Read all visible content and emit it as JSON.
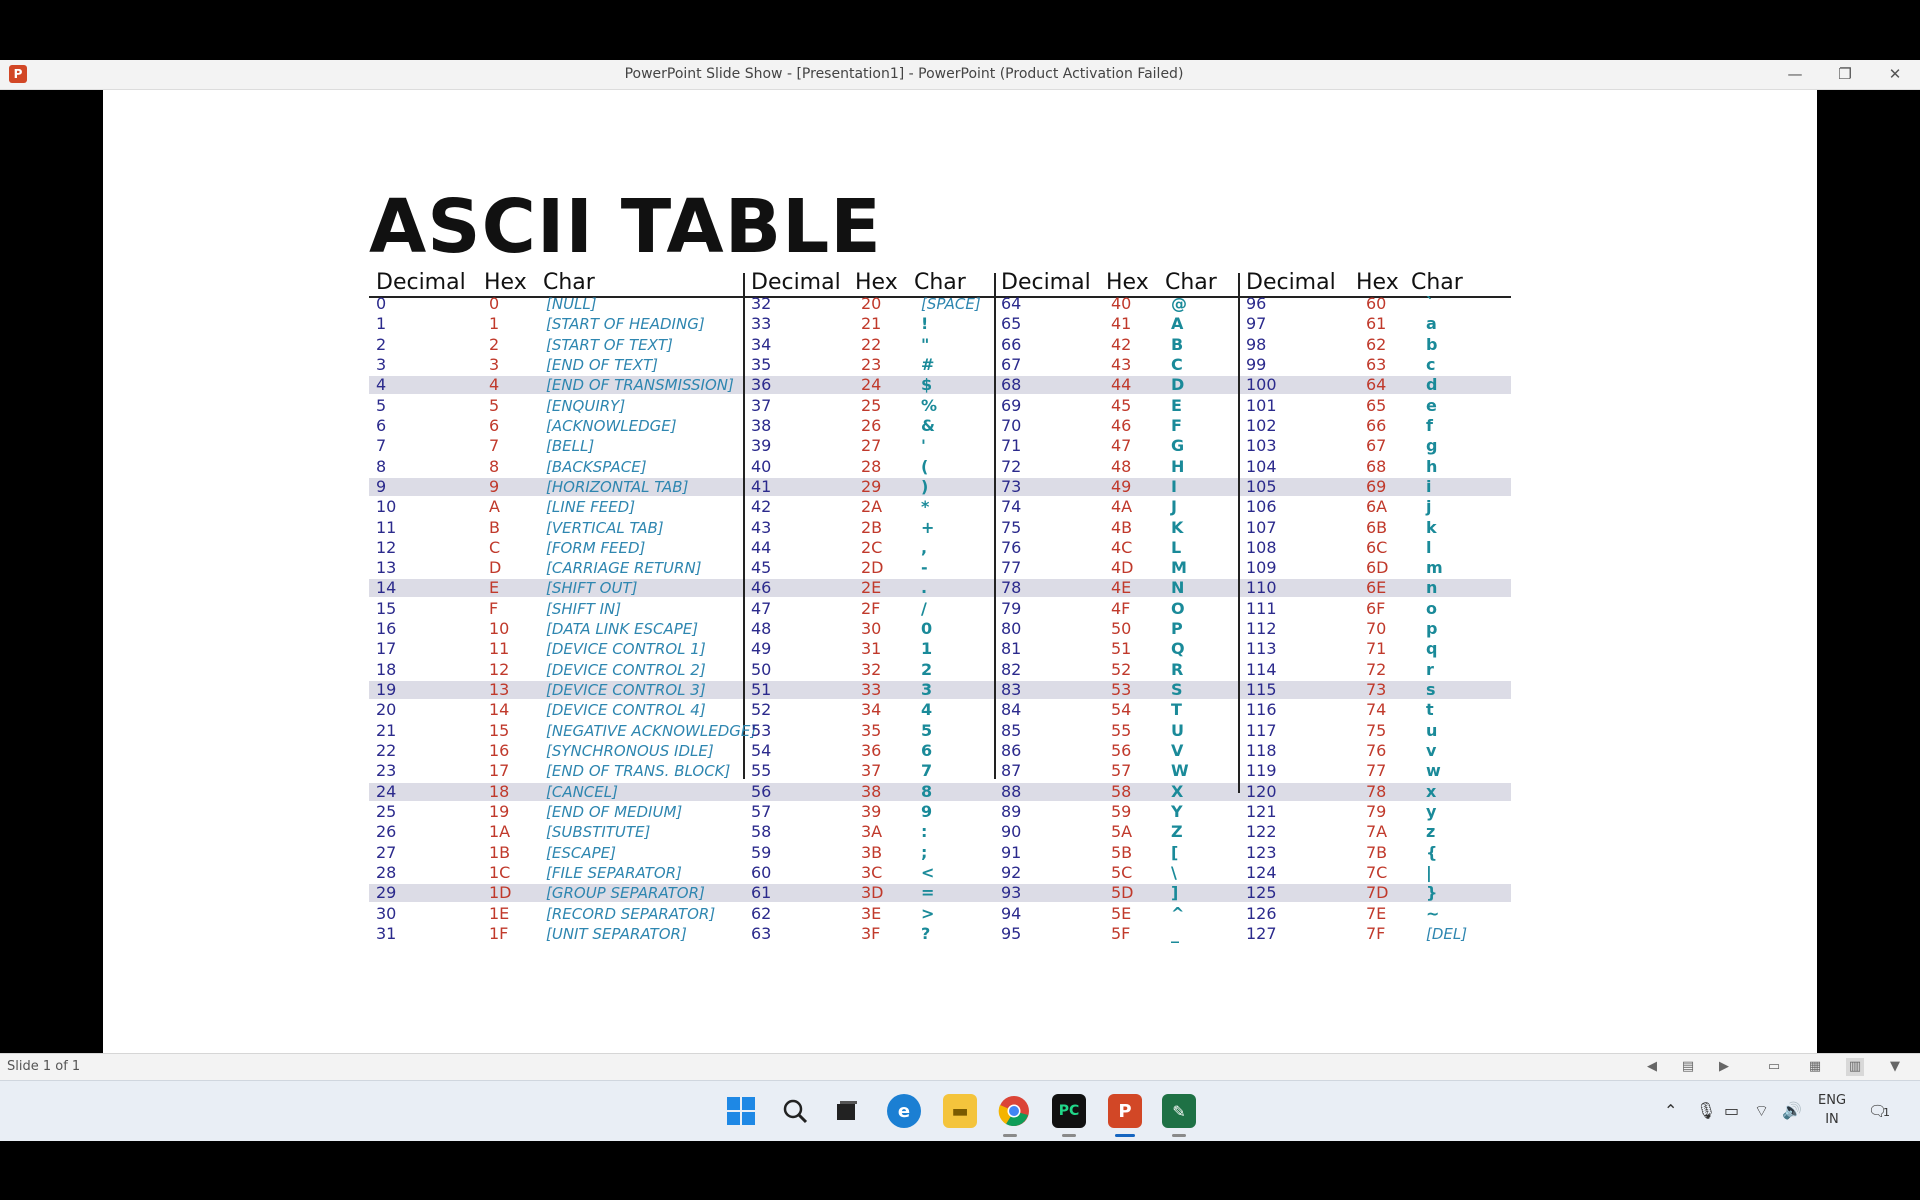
{
  "window": {
    "title": "PowerPoint Slide Show - [Presentation1] - PowerPoint (Product Activation Failed)",
    "app_icon": "P",
    "minimize": "—",
    "restore": "❐",
    "close": "✕"
  },
  "slide": {
    "title": "ASCII TABLE",
    "headers": {
      "decimal": "Decimal",
      "hex": "Hex",
      "char": "Char"
    },
    "groups": [
      {
        "rows": [
          [
            "0",
            "0",
            "[NULL]"
          ],
          [
            "1",
            "1",
            "[START OF HEADING]"
          ],
          [
            "2",
            "2",
            "[START OF TEXT]"
          ],
          [
            "3",
            "3",
            "[END OF TEXT]"
          ],
          [
            "4",
            "4",
            "[END OF TRANSMISSION]"
          ],
          [
            "5",
            "5",
            "[ENQUIRY]"
          ],
          [
            "6",
            "6",
            "[ACKNOWLEDGE]"
          ],
          [
            "7",
            "7",
            "[BELL]"
          ],
          [
            "8",
            "8",
            "[BACKSPACE]"
          ],
          [
            "9",
            "9",
            "[HORIZONTAL TAB]"
          ],
          [
            "10",
            "A",
            "[LINE FEED]"
          ],
          [
            "11",
            "B",
            "[VERTICAL TAB]"
          ],
          [
            "12",
            "C",
            "[FORM FEED]"
          ],
          [
            "13",
            "D",
            "[CARRIAGE RETURN]"
          ],
          [
            "14",
            "E",
            "[SHIFT OUT]"
          ],
          [
            "15",
            "F",
            "[SHIFT IN]"
          ],
          [
            "16",
            "10",
            "[DATA LINK ESCAPE]"
          ],
          [
            "17",
            "11",
            "[DEVICE CONTROL 1]"
          ],
          [
            "18",
            "12",
            "[DEVICE CONTROL 2]"
          ],
          [
            "19",
            "13",
            "[DEVICE CONTROL 3]"
          ],
          [
            "20",
            "14",
            "[DEVICE CONTROL 4]"
          ],
          [
            "21",
            "15",
            "[NEGATIVE ACKNOWLEDGE]"
          ],
          [
            "22",
            "16",
            "[SYNCHRONOUS IDLE]"
          ],
          [
            "23",
            "17",
            "[END OF TRANS. BLOCK]"
          ],
          [
            "24",
            "18",
            "[CANCEL]"
          ],
          [
            "25",
            "19",
            "[END OF MEDIUM]"
          ],
          [
            "26",
            "1A",
            "[SUBSTITUTE]"
          ],
          [
            "27",
            "1B",
            "[ESCAPE]"
          ],
          [
            "28",
            "1C",
            "[FILE SEPARATOR]"
          ],
          [
            "29",
            "1D",
            "[GROUP SEPARATOR]"
          ],
          [
            "30",
            "1E",
            "[RECORD SEPARATOR]"
          ],
          [
            "31",
            "1F",
            "[UNIT SEPARATOR]"
          ]
        ]
      },
      {
        "rows": [
          [
            "32",
            "20",
            "[SPACE]"
          ],
          [
            "33",
            "21",
            "!"
          ],
          [
            "34",
            "22",
            "\""
          ],
          [
            "35",
            "23",
            "#"
          ],
          [
            "36",
            "24",
            "$"
          ],
          [
            "37",
            "25",
            "%"
          ],
          [
            "38",
            "26",
            "&"
          ],
          [
            "39",
            "27",
            "'"
          ],
          [
            "40",
            "28",
            "("
          ],
          [
            "41",
            "29",
            ")"
          ],
          [
            "42",
            "2A",
            "*"
          ],
          [
            "43",
            "2B",
            "+"
          ],
          [
            "44",
            "2C",
            ","
          ],
          [
            "45",
            "2D",
            "-"
          ],
          [
            "46",
            "2E",
            "."
          ],
          [
            "47",
            "2F",
            "/"
          ],
          [
            "48",
            "30",
            "0"
          ],
          [
            "49",
            "31",
            "1"
          ],
          [
            "50",
            "32",
            "2"
          ],
          [
            "51",
            "33",
            "3"
          ],
          [
            "52",
            "34",
            "4"
          ],
          [
            "53",
            "35",
            "5"
          ],
          [
            "54",
            "36",
            "6"
          ],
          [
            "55",
            "37",
            "7"
          ],
          [
            "56",
            "38",
            "8"
          ],
          [
            "57",
            "39",
            "9"
          ],
          [
            "58",
            "3A",
            ":"
          ],
          [
            "59",
            "3B",
            ";"
          ],
          [
            "60",
            "3C",
            "<"
          ],
          [
            "61",
            "3D",
            "="
          ],
          [
            "62",
            "3E",
            ">"
          ],
          [
            "63",
            "3F",
            "?"
          ]
        ]
      },
      {
        "rows": [
          [
            "64",
            "40",
            "@"
          ],
          [
            "65",
            "41",
            "A"
          ],
          [
            "66",
            "42",
            "B"
          ],
          [
            "67",
            "43",
            "C"
          ],
          [
            "68",
            "44",
            "D"
          ],
          [
            "69",
            "45",
            "E"
          ],
          [
            "70",
            "46",
            "F"
          ],
          [
            "71",
            "47",
            "G"
          ],
          [
            "72",
            "48",
            "H"
          ],
          [
            "73",
            "49",
            "I"
          ],
          [
            "74",
            "4A",
            "J"
          ],
          [
            "75",
            "4B",
            "K"
          ],
          [
            "76",
            "4C",
            "L"
          ],
          [
            "77",
            "4D",
            "M"
          ],
          [
            "78",
            "4E",
            "N"
          ],
          [
            "79",
            "4F",
            "O"
          ],
          [
            "80",
            "50",
            "P"
          ],
          [
            "81",
            "51",
            "Q"
          ],
          [
            "82",
            "52",
            "R"
          ],
          [
            "83",
            "53",
            "S"
          ],
          [
            "84",
            "54",
            "T"
          ],
          [
            "85",
            "55",
            "U"
          ],
          [
            "86",
            "56",
            "V"
          ],
          [
            "87",
            "57",
            "W"
          ],
          [
            "88",
            "58",
            "X"
          ],
          [
            "89",
            "59",
            "Y"
          ],
          [
            "90",
            "5A",
            "Z"
          ],
          [
            "91",
            "5B",
            "["
          ],
          [
            "92",
            "5C",
            "\\"
          ],
          [
            "93",
            "5D",
            "]"
          ],
          [
            "94",
            "5E",
            "^"
          ],
          [
            "95",
            "5F",
            "_"
          ]
        ]
      },
      {
        "rows": [
          [
            "96",
            "60",
            "`"
          ],
          [
            "97",
            "61",
            "a"
          ],
          [
            "98",
            "62",
            "b"
          ],
          [
            "99",
            "63",
            "c"
          ],
          [
            "100",
            "64",
            "d"
          ],
          [
            "101",
            "65",
            "e"
          ],
          [
            "102",
            "66",
            "f"
          ],
          [
            "103",
            "67",
            "g"
          ],
          [
            "104",
            "68",
            "h"
          ],
          [
            "105",
            "69",
            "i"
          ],
          [
            "106",
            "6A",
            "j"
          ],
          [
            "107",
            "6B",
            "k"
          ],
          [
            "108",
            "6C",
            "l"
          ],
          [
            "109",
            "6D",
            "m"
          ],
          [
            "110",
            "6E",
            "n"
          ],
          [
            "111",
            "6F",
            "o"
          ],
          [
            "112",
            "70",
            "p"
          ],
          [
            "113",
            "71",
            "q"
          ],
          [
            "114",
            "72",
            "r"
          ],
          [
            "115",
            "73",
            "s"
          ],
          [
            "116",
            "74",
            "t"
          ],
          [
            "117",
            "75",
            "u"
          ],
          [
            "118",
            "76",
            "v"
          ],
          [
            "119",
            "77",
            "w"
          ],
          [
            "120",
            "78",
            "x"
          ],
          [
            "121",
            "79",
            "y"
          ],
          [
            "122",
            "7A",
            "z"
          ],
          [
            "123",
            "7B",
            "{"
          ],
          [
            "124",
            "7C",
            "|"
          ],
          [
            "125",
            "7D",
            "}"
          ],
          [
            "126",
            "7E",
            "~"
          ],
          [
            "127",
            "7F",
            "[DEL]"
          ]
        ]
      }
    ]
  },
  "status": {
    "slide_count": "Slide 1 of 1"
  },
  "statusbar_icons": [
    "prev-slide-icon",
    "slide-menu-icon",
    "next-slide-icon",
    "normal-view-icon",
    "slide-sorter-icon",
    "reading-view-icon",
    "slideshow-icon"
  ],
  "taskbar": {
    "apps": [
      "windows-start-icon",
      "search-icon",
      "task-view-icon",
      "edge-icon",
      "file-explorer-icon",
      "chrome-icon",
      "pycharm-icon",
      "powerpoint-icon",
      "excel-icon"
    ],
    "tray": {
      "lang_line1": "ENG",
      "lang_line2": "IN",
      "notifications": "1"
    }
  },
  "colors": {
    "decimal": "#2b2a8c",
    "hex": "#c0392b",
    "control": "#2e86b0",
    "char": "#1a8a99",
    "band": "#dcdce6"
  }
}
